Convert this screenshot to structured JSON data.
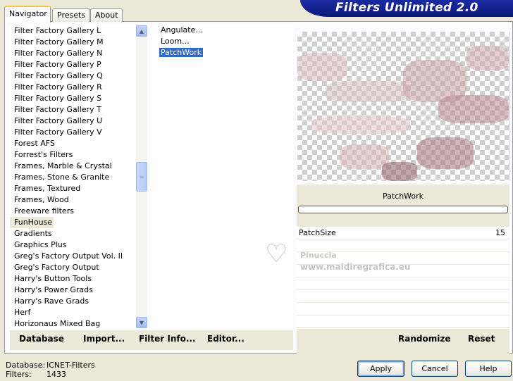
{
  "tabs": [
    "Navigator",
    "Presets",
    "About"
  ],
  "title": "Filters Unlimited 2.0",
  "categories": [
    "Filter Factory Gallery L",
    "Filter Factory Gallery M",
    "Filter Factory Gallery N",
    "Filter Factory Gallery P",
    "Filter Factory Gallery Q",
    "Filter Factory Gallery R",
    "Filter Factory Gallery S",
    "Filter Factory Gallery T",
    "Filter Factory Gallery U",
    "Filter Factory Gallery V",
    "Forest AFS",
    "Forrest's Filters",
    "Frames, Marble & Crystal",
    "Frames, Stone & Granite",
    "Frames, Textured",
    "Frames, Wood",
    "Freeware filters",
    "FunHouse",
    "Gradients",
    "Graphics Plus",
    "Greg's Factory Output Vol. II",
    "Greg's Factory Output",
    "Harry's Button Tools",
    "Harry's Power Grads",
    "Harry's Rave Grads",
    "Herf",
    "Horizonaus Mixed Bag"
  ],
  "selected_category": "FunHouse",
  "filters": [
    "Angulate...",
    "Loom...",
    "PatchWork"
  ],
  "selected_filter": "PatchWork",
  "left_buttons": [
    "Database",
    "Import...",
    "Filter Info...",
    "Editor..."
  ],
  "preview_title": "PatchWork",
  "params": [
    {
      "label": "PatchSize",
      "value": "15"
    }
  ],
  "right_buttons": {
    "randomize": "Randomize",
    "reset": "Reset"
  },
  "watermark": {
    "line1": "Pinuccia",
    "line2": "www.maidiregrafica.eu"
  },
  "footer": {
    "database_label": "Database:",
    "database_value": "ICNET-Filters",
    "filters_label": "Filters:",
    "filters_value": "1433"
  },
  "dialog_buttons": {
    "apply": "Apply",
    "cancel": "Cancel",
    "help": "Help"
  },
  "icons": {
    "scroll_up": "chevron-up-icon",
    "scroll_down": "chevron-down-icon",
    "grip": "grip-icon"
  },
  "colors": {
    "banner": "#0a1a7a",
    "selection": "#316ac5",
    "tab_highlight": "#ffc83c"
  }
}
